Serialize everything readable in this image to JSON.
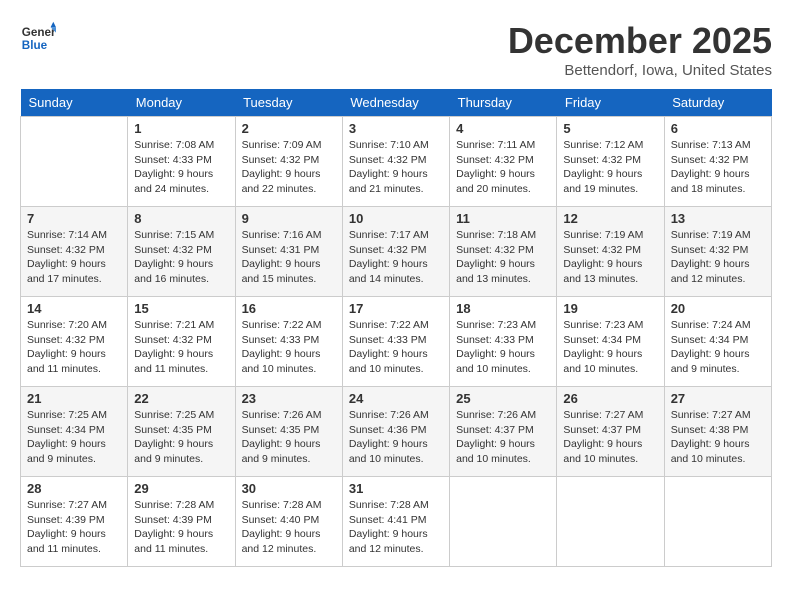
{
  "logo": {
    "general": "General",
    "blue": "Blue"
  },
  "title": "December 2025",
  "location": "Bettendorf, Iowa, United States",
  "days_of_week": [
    "Sunday",
    "Monday",
    "Tuesday",
    "Wednesday",
    "Thursday",
    "Friday",
    "Saturday"
  ],
  "weeks": [
    [
      {
        "day": "",
        "info": ""
      },
      {
        "day": "1",
        "info": "Sunrise: 7:08 AM\nSunset: 4:33 PM\nDaylight: 9 hours and 24 minutes."
      },
      {
        "day": "2",
        "info": "Sunrise: 7:09 AM\nSunset: 4:32 PM\nDaylight: 9 hours and 22 minutes."
      },
      {
        "day": "3",
        "info": "Sunrise: 7:10 AM\nSunset: 4:32 PM\nDaylight: 9 hours and 21 minutes."
      },
      {
        "day": "4",
        "info": "Sunrise: 7:11 AM\nSunset: 4:32 PM\nDaylight: 9 hours and 20 minutes."
      },
      {
        "day": "5",
        "info": "Sunrise: 7:12 AM\nSunset: 4:32 PM\nDaylight: 9 hours and 19 minutes."
      },
      {
        "day": "6",
        "info": "Sunrise: 7:13 AM\nSunset: 4:32 PM\nDaylight: 9 hours and 18 minutes."
      }
    ],
    [
      {
        "day": "7",
        "info": "Sunrise: 7:14 AM\nSunset: 4:32 PM\nDaylight: 9 hours and 17 minutes."
      },
      {
        "day": "8",
        "info": "Sunrise: 7:15 AM\nSunset: 4:32 PM\nDaylight: 9 hours and 16 minutes."
      },
      {
        "day": "9",
        "info": "Sunrise: 7:16 AM\nSunset: 4:31 PM\nDaylight: 9 hours and 15 minutes."
      },
      {
        "day": "10",
        "info": "Sunrise: 7:17 AM\nSunset: 4:32 PM\nDaylight: 9 hours and 14 minutes."
      },
      {
        "day": "11",
        "info": "Sunrise: 7:18 AM\nSunset: 4:32 PM\nDaylight: 9 hours and 13 minutes."
      },
      {
        "day": "12",
        "info": "Sunrise: 7:19 AM\nSunset: 4:32 PM\nDaylight: 9 hours and 13 minutes."
      },
      {
        "day": "13",
        "info": "Sunrise: 7:19 AM\nSunset: 4:32 PM\nDaylight: 9 hours and 12 minutes."
      }
    ],
    [
      {
        "day": "14",
        "info": "Sunrise: 7:20 AM\nSunset: 4:32 PM\nDaylight: 9 hours and 11 minutes."
      },
      {
        "day": "15",
        "info": "Sunrise: 7:21 AM\nSunset: 4:32 PM\nDaylight: 9 hours and 11 minutes."
      },
      {
        "day": "16",
        "info": "Sunrise: 7:22 AM\nSunset: 4:33 PM\nDaylight: 9 hours and 10 minutes."
      },
      {
        "day": "17",
        "info": "Sunrise: 7:22 AM\nSunset: 4:33 PM\nDaylight: 9 hours and 10 minutes."
      },
      {
        "day": "18",
        "info": "Sunrise: 7:23 AM\nSunset: 4:33 PM\nDaylight: 9 hours and 10 minutes."
      },
      {
        "day": "19",
        "info": "Sunrise: 7:23 AM\nSunset: 4:34 PM\nDaylight: 9 hours and 10 minutes."
      },
      {
        "day": "20",
        "info": "Sunrise: 7:24 AM\nSunset: 4:34 PM\nDaylight: 9 hours and 9 minutes."
      }
    ],
    [
      {
        "day": "21",
        "info": "Sunrise: 7:25 AM\nSunset: 4:34 PM\nDaylight: 9 hours and 9 minutes."
      },
      {
        "day": "22",
        "info": "Sunrise: 7:25 AM\nSunset: 4:35 PM\nDaylight: 9 hours and 9 minutes."
      },
      {
        "day": "23",
        "info": "Sunrise: 7:26 AM\nSunset: 4:35 PM\nDaylight: 9 hours and 9 minutes."
      },
      {
        "day": "24",
        "info": "Sunrise: 7:26 AM\nSunset: 4:36 PM\nDaylight: 9 hours and 10 minutes."
      },
      {
        "day": "25",
        "info": "Sunrise: 7:26 AM\nSunset: 4:37 PM\nDaylight: 9 hours and 10 minutes."
      },
      {
        "day": "26",
        "info": "Sunrise: 7:27 AM\nSunset: 4:37 PM\nDaylight: 9 hours and 10 minutes."
      },
      {
        "day": "27",
        "info": "Sunrise: 7:27 AM\nSunset: 4:38 PM\nDaylight: 9 hours and 10 minutes."
      }
    ],
    [
      {
        "day": "28",
        "info": "Sunrise: 7:27 AM\nSunset: 4:39 PM\nDaylight: 9 hours and 11 minutes."
      },
      {
        "day": "29",
        "info": "Sunrise: 7:28 AM\nSunset: 4:39 PM\nDaylight: 9 hours and 11 minutes."
      },
      {
        "day": "30",
        "info": "Sunrise: 7:28 AM\nSunset: 4:40 PM\nDaylight: 9 hours and 12 minutes."
      },
      {
        "day": "31",
        "info": "Sunrise: 7:28 AM\nSunset: 4:41 PM\nDaylight: 9 hours and 12 minutes."
      },
      {
        "day": "",
        "info": ""
      },
      {
        "day": "",
        "info": ""
      },
      {
        "day": "",
        "info": ""
      }
    ]
  ],
  "accent_color": "#1565c0"
}
